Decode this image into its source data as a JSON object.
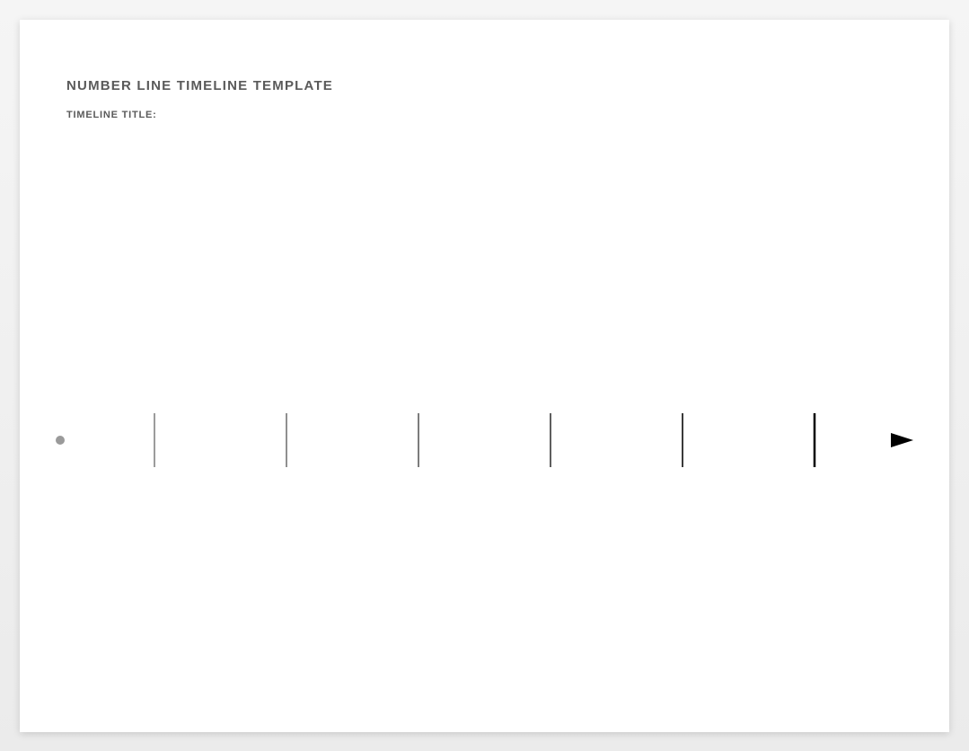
{
  "header": {
    "title": "NUMBER LINE TIMELINE TEMPLATE",
    "subtitle": "TIMELINE TITLE:"
  },
  "timeline": {
    "tick_count": 6,
    "start_circle": true,
    "end_arrow": true
  }
}
